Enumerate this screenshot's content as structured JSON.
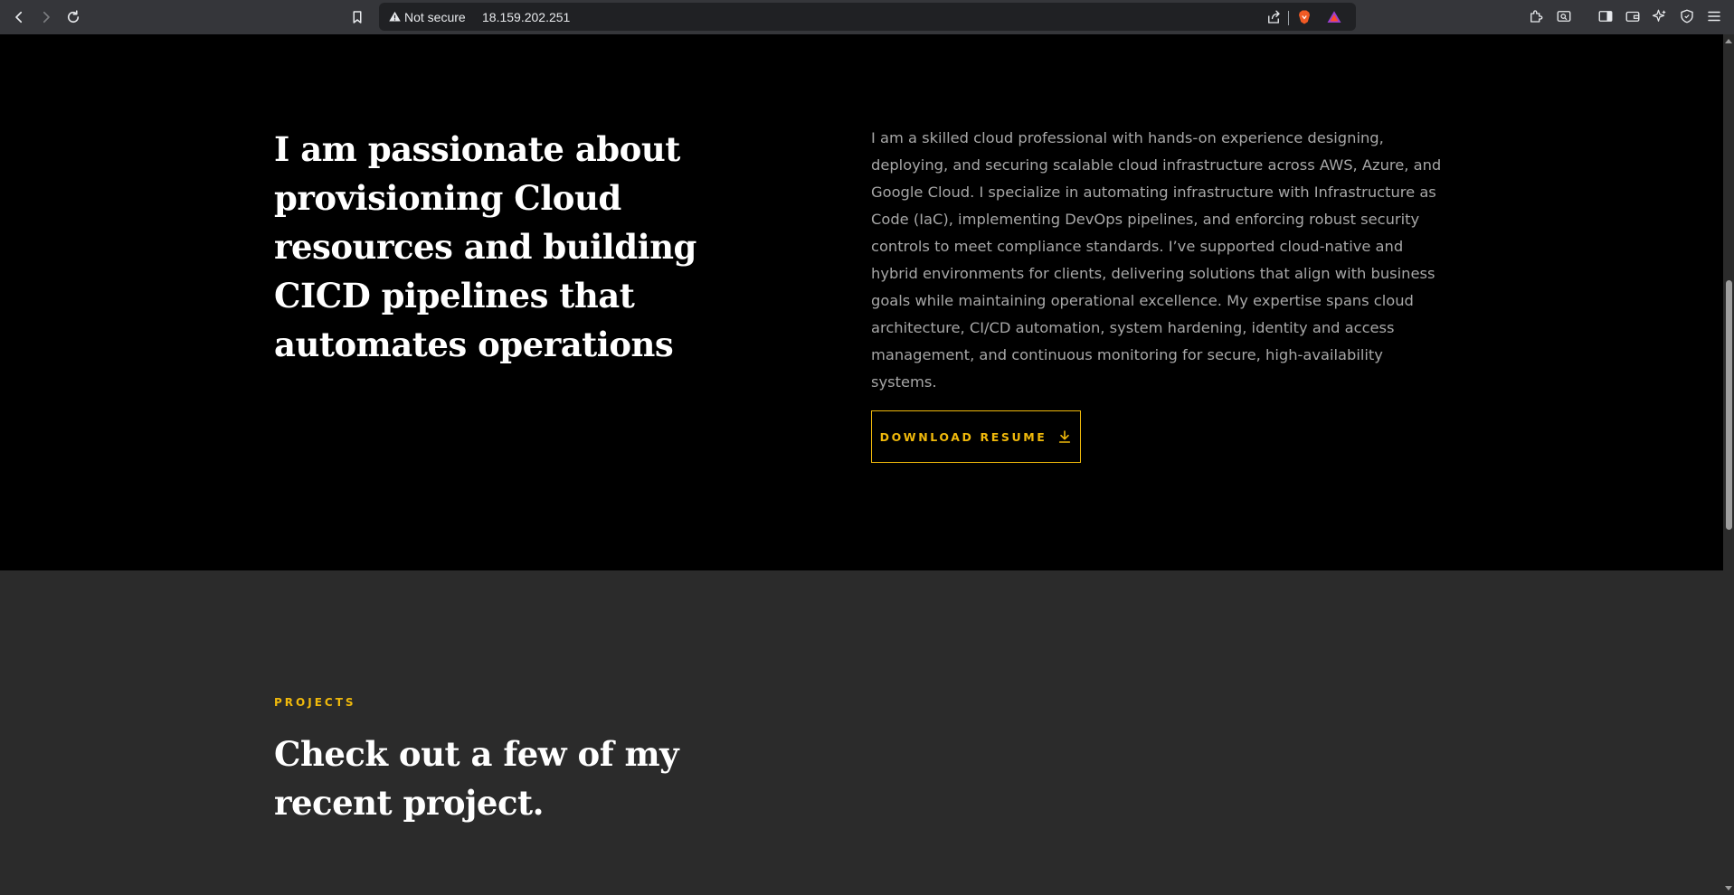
{
  "browser": {
    "security_label": "Not secure",
    "url": "18.159.202.251"
  },
  "about": {
    "heading": "I am passionate about provisioning Cloud resources and building CICD pipelines that automates operations",
    "body": "I am a skilled cloud professional with hands-on experience designing, deploying, and securing scalable cloud infrastructure across AWS, Azure, and Google Cloud. I specialize in automating infrastructure with Infrastructure as Code (IaC), implementing DevOps pipelines, and enforcing robust security controls to meet compliance standards. I’ve supported cloud-native and hybrid environments for clients, delivering solutions that align with business goals while maintaining operational excellence. My expertise spans cloud architecture, CI/CD automation, system hardening, identity and access management, and continuous monitoring for secure, high-availability systems.",
    "resume_button_label": "DOWNLOAD RESUME",
    "resume_icon": "download-icon"
  },
  "projects": {
    "eyebrow": "PROJECTS",
    "heading": "Check out a few of my recent project."
  },
  "colors": {
    "accent": "#f0b90b",
    "about_bg": "#000000",
    "projects_bg": "#2b2b2b",
    "body_text": "#a7a7a7"
  }
}
